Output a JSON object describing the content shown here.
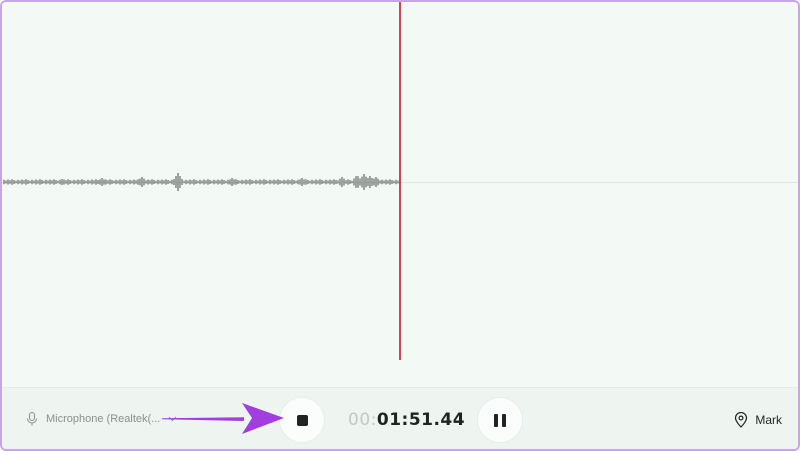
{
  "input_device": {
    "label": "Microphone (Realtek(...",
    "icon": "microphone-icon"
  },
  "recording": {
    "timer_dim": "00:",
    "timer_main": "01:51.44",
    "stop_icon": "stop-icon",
    "pause_icon": "pause-icon"
  },
  "mark": {
    "label": "Mark",
    "icon": "location-pin-icon"
  },
  "colors": {
    "playhead": "#d4444a",
    "annotation_arrow": "#a23ee0",
    "frame_border": "#c7a6e8",
    "background": "#f3faf5"
  }
}
